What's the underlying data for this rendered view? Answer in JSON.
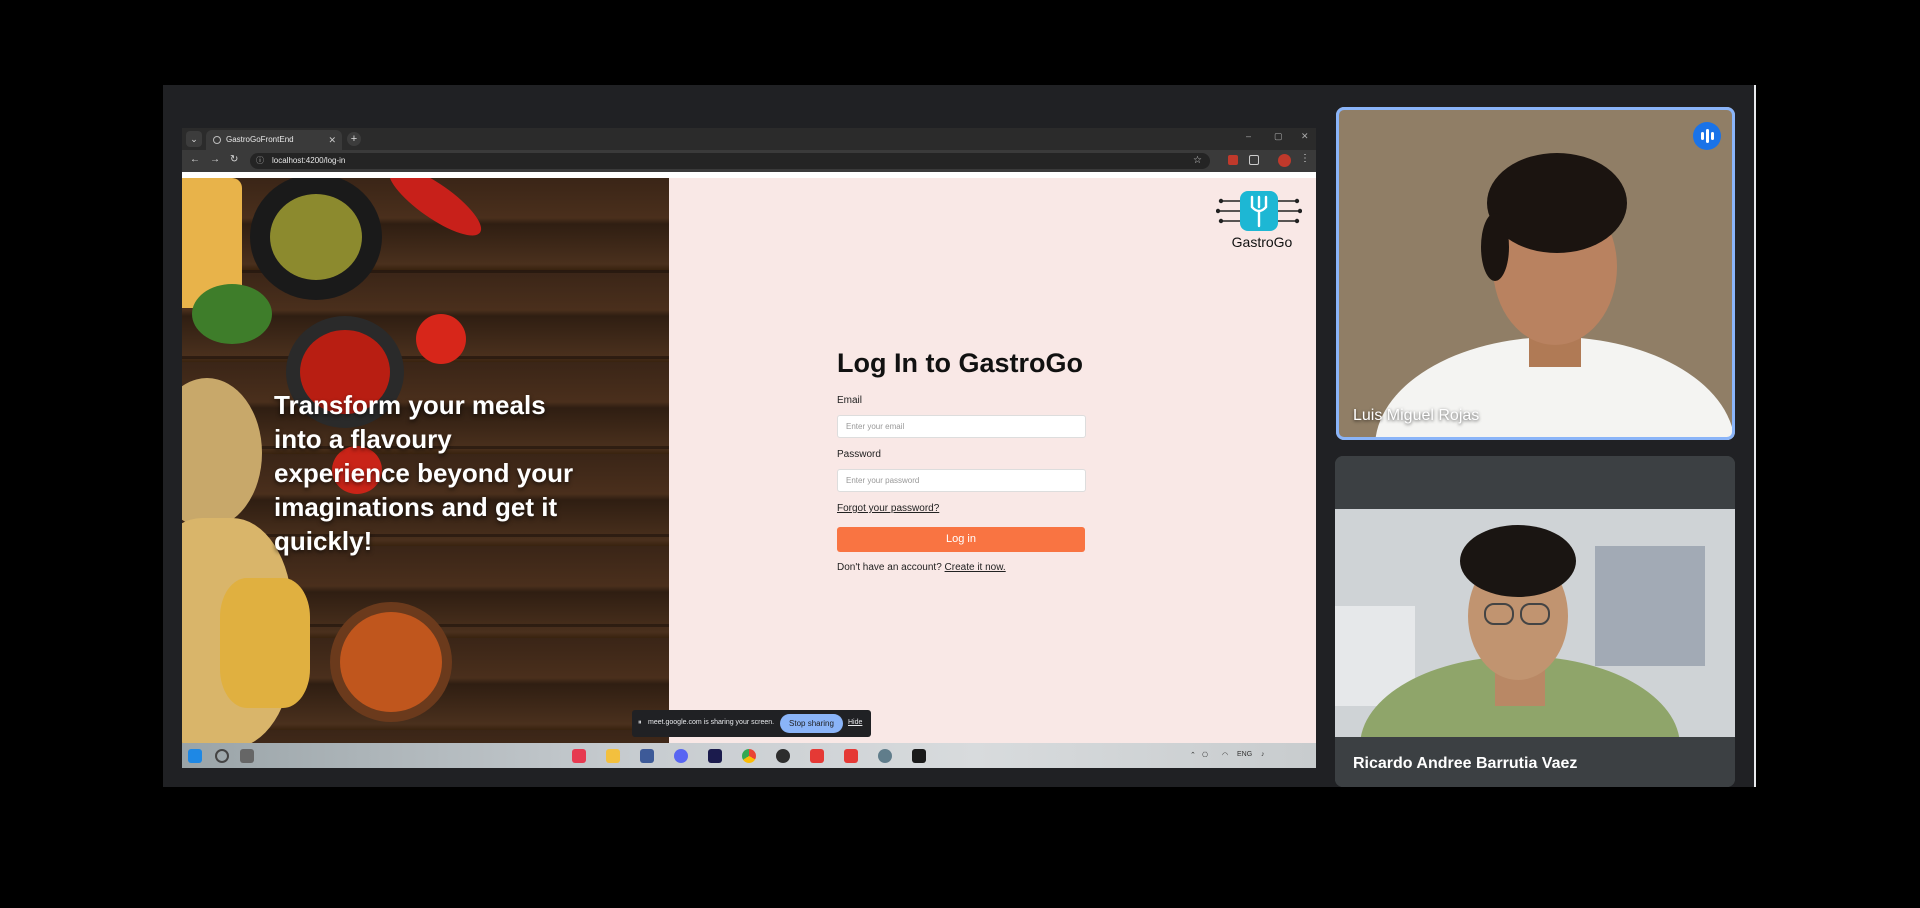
{
  "browser": {
    "tab_title": "GastroGoFrontEnd",
    "tab_close": "✕",
    "new_tab": "+",
    "url": "localhost:4200/log-in"
  },
  "hero": {
    "tagline": "Transform your meals into a flavoury experience beyond your imaginations and get it quickly!"
  },
  "brand": {
    "name": "GastroGo",
    "accent": "#1db7d4"
  },
  "login": {
    "title": "Log In to GastroGo",
    "email_label": "Email",
    "email_placeholder": "Enter your email",
    "password_label": "Password",
    "password_placeholder": "Enter your password",
    "forgot": "Forgot your password?",
    "submit": "Log in",
    "submit_color": "#f97442",
    "signup_prompt": "Don't have an account?",
    "signup_link": "Create it now."
  },
  "share_bar": {
    "message": "meet.google.com is sharing your screen.",
    "stop": "Stop sharing",
    "hide": "Hide"
  },
  "taskbar": {
    "lang": "ENG"
  },
  "participants": [
    {
      "name": "Luis Miguel Rojas"
    },
    {
      "name": "Ricardo Andree Barrutia Vaez"
    }
  ]
}
